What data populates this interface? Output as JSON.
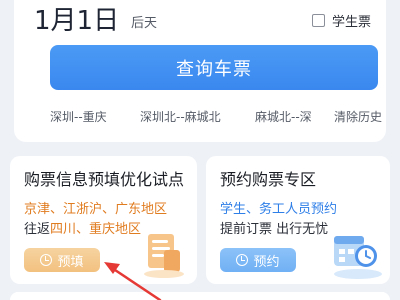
{
  "date": {
    "main": "1月1日",
    "sub": "后天"
  },
  "student": {
    "label": "学生票"
  },
  "query": {
    "label": "查询车票"
  },
  "history": [
    "深圳--重庆",
    "深圳北--麻城北",
    "麻城北--深",
    "清除历史"
  ],
  "cards": {
    "left": {
      "title": "购票信息预填优化试点",
      "line1": "京津、江浙沪、广东地区",
      "line2_prefix": "往返",
      "line2_highlight": "四川、重庆地区",
      "button": "预填"
    },
    "right": {
      "title": "预约购票专区",
      "line1": "学生、务工人员预约",
      "line2": "提前订票 出行无忧",
      "button": "预约"
    }
  },
  "colors": {
    "accent": "#3a88ef",
    "orange": "#e07c20",
    "annotation_arrow": "#e53935"
  }
}
